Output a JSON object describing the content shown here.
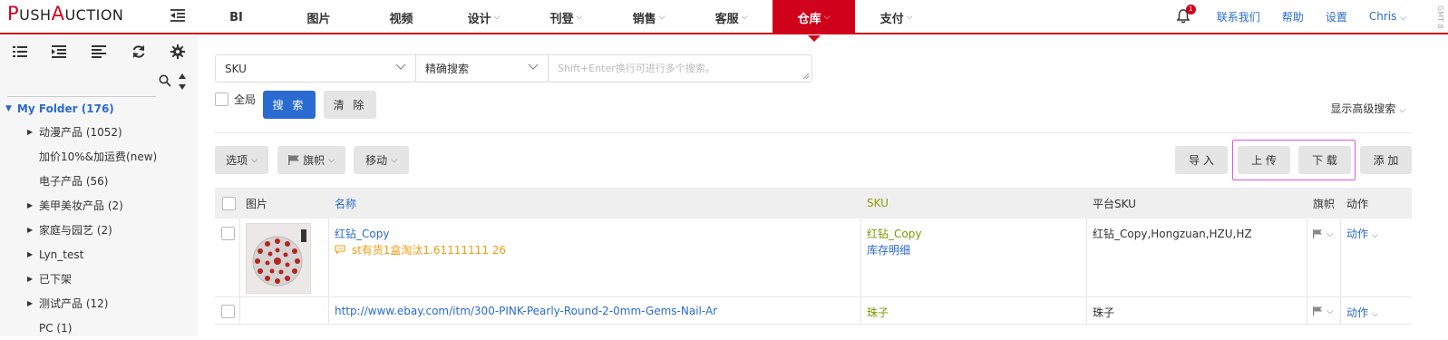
{
  "brand": {
    "logo_p": "P",
    "logo_ush": "USH",
    "logo_a": "A",
    "logo_uction": "UCTION"
  },
  "nav": {
    "items": [
      {
        "label": "BI",
        "dropdown": false,
        "active": false
      },
      {
        "label": "图片",
        "dropdown": false,
        "active": false
      },
      {
        "label": "视频",
        "dropdown": false,
        "active": false
      },
      {
        "label": "设计",
        "dropdown": true,
        "active": false
      },
      {
        "label": "刊登",
        "dropdown": true,
        "active": false
      },
      {
        "label": "销售",
        "dropdown": true,
        "active": false
      },
      {
        "label": "客服",
        "dropdown": true,
        "active": false
      },
      {
        "label": "仓库",
        "dropdown": true,
        "active": true
      },
      {
        "label": "支付",
        "dropdown": true,
        "active": false
      }
    ],
    "notification_count": "1",
    "contact": "联系我们",
    "help": "帮助",
    "settings": "设置",
    "user": "Chris",
    "timezone": "GMT 8"
  },
  "sidebar": {
    "root": "My Folder (176)",
    "folders": [
      {
        "label": "动漫产品 (1052)",
        "expandable": true
      },
      {
        "label": "加价10%&加运费(new)",
        "expandable": false
      },
      {
        "label": "电子产品 (56)",
        "expandable": false
      },
      {
        "label": "美甲美妆产品 (2)",
        "expandable": true
      },
      {
        "label": "家庭与园艺 (2)",
        "expandable": true
      },
      {
        "label": "Lyn_test",
        "expandable": true
      },
      {
        "label": "已下架",
        "expandable": true
      },
      {
        "label": "测试产品 (12)",
        "expandable": true
      },
      {
        "label": "PC (1)",
        "expandable": false
      }
    ]
  },
  "search": {
    "field": "SKU",
    "mode": "精确搜索",
    "placeholder": "Shift+Enter换行可进行多个搜索。",
    "global_label": "全局",
    "search_button": "搜 索",
    "clear_button": "清 除",
    "advanced": "显示高级搜索"
  },
  "toolbar": {
    "options": "选项",
    "flag": "旗帜",
    "move": "移动",
    "import": "导 入",
    "upload": "上 传",
    "download": "下 载",
    "add": "添 加"
  },
  "table": {
    "headers": {
      "image": "图片",
      "name": "名称",
      "sku": "SKU",
      "platform_sku": "平台SKU",
      "flag": "旗帜",
      "action": "动作"
    },
    "rows": [
      {
        "name": "红钻_Copy",
        "note": "st有货1盒淘汰1.61111111 26",
        "sku": "红钻_Copy",
        "stock_link": "库存明细",
        "platform_sku": "红钻_Copy,Hongzuan,HZU,HZ",
        "action": "动作"
      },
      {
        "name": "http://www.ebay.com/itm/300-PINK-Pearly-Round-2-0mm-Gems-Nail-Ar",
        "sku": "珠子",
        "platform_sku": "珠子",
        "action": "动作"
      }
    ]
  },
  "colors": {
    "brand_red": "#d0021b",
    "link_blue": "#2a6bd1",
    "sku_green": "#7a9a00",
    "note_orange": "#f39c12",
    "highlight_pink": "#e055e0"
  }
}
